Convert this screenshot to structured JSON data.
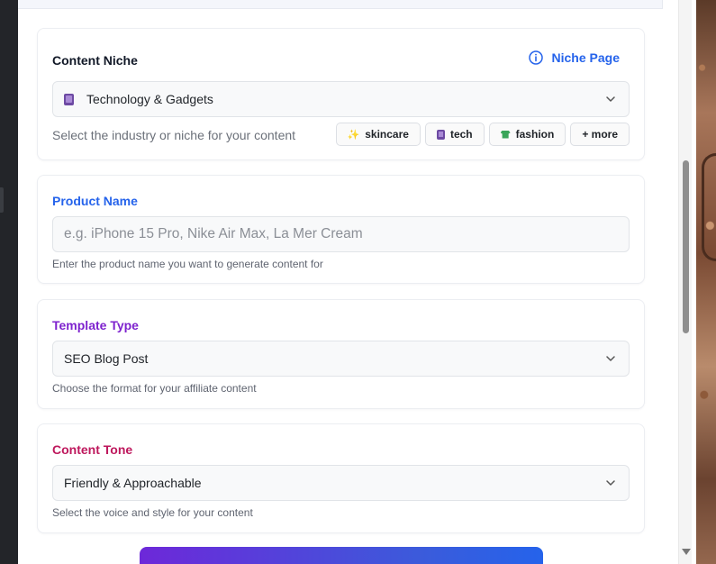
{
  "niche": {
    "label": "Content Niche",
    "link_label": "Niche Page",
    "selected": "Technology & Gadgets",
    "helper": "Select the industry or niche for your content",
    "chips": [
      "skincare",
      "tech",
      "fashion",
      "+ more"
    ]
  },
  "product": {
    "label": "Product Name",
    "placeholder": "e.g. iPhone 15 Pro, Nike Air Max, La Mer Cream",
    "helper": "Enter the product name you want to generate content for"
  },
  "template": {
    "label": "Template Type",
    "selected": "SEO Blog Post",
    "helper": "Choose the format for your affiliate content"
  },
  "tone": {
    "label": "Content Tone",
    "selected": "Friendly & Approachable",
    "helper": "Select the voice and style for your content"
  },
  "colors": {
    "product_label": "#2563eb",
    "template_label": "#7e22ce",
    "tone_label": "#be185d",
    "link": "#2563eb"
  }
}
